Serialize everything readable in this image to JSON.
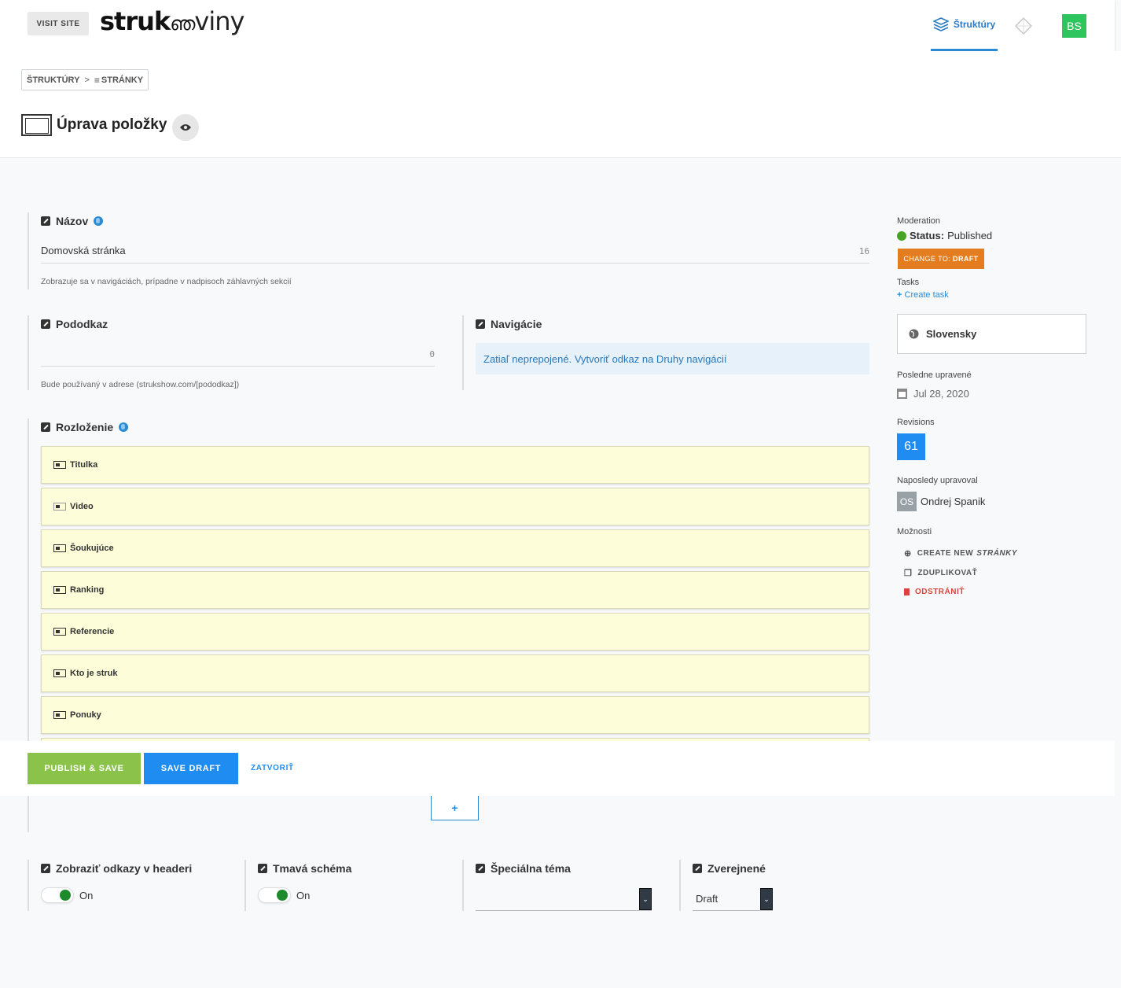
{
  "topbar": {
    "visit_site": "VISIT SITE",
    "logo_bold": "struk",
    "logo_light": "viny",
    "nav_active": "Štruktúry",
    "avatar": "BS"
  },
  "breadcrumb": {
    "root": "ŠTRUKTÚRY",
    "separator": ">",
    "current": "STRÁNKY"
  },
  "page": {
    "title": "Úprava položky"
  },
  "fields": {
    "nazov": {
      "label": "Názov",
      "value": "Domovská stránka",
      "counter": "16",
      "help": "Zobrazuje sa v navigáciách, prípadne v nadpisoch záhlavných sekcií"
    },
    "pododkaz": {
      "label": "Pododkaz",
      "value": "",
      "counter": "0",
      "help": "Bude používaný v adrese (strukshow.com/[pododkaz])"
    },
    "navigacie": {
      "label": "Navigácie",
      "text": "Zatiaľ neprepojené.",
      "link": "Vytvoriť odkaz na Druhy navigácií"
    },
    "rozlozenie": {
      "label": "Rozloženie",
      "items": [
        {
          "label": "Titulka",
          "icon": "slider-icon"
        },
        {
          "label": "Video",
          "icon": "video-icon"
        },
        {
          "label": "Šoukujúce",
          "icon": "slider-icon"
        },
        {
          "label": "Ranking",
          "icon": "ranking-icon"
        },
        {
          "label": "Referencie",
          "icon": "quote-icon"
        },
        {
          "label": "Kto je struk",
          "icon": "image-text-icon"
        },
        {
          "label": "Ponuky",
          "icon": "image-text-icon"
        }
      ]
    },
    "odkazy": {
      "label": "Zobraziť odkazy v headeri",
      "state": "On"
    },
    "tmava": {
      "label": "Tmavá schéma",
      "state": "On"
    },
    "tema": {
      "label": "Špeciálna téma",
      "value": ""
    },
    "zverejnene": {
      "label": "Zverejnené",
      "value": "Draft"
    }
  },
  "actions": {
    "publish": "PUBLISH & SAVE",
    "draft": "SAVE DRAFT",
    "close": "ZATVORIŤ",
    "add": "+"
  },
  "sidebar": {
    "moderation_label": "Moderation",
    "status_key": "Status:",
    "status_value": "Published",
    "change_prefix": "CHANGE TO:",
    "change_target": "DRAFT",
    "tasks_label": "Tasks",
    "create_task": "Create task",
    "language": "Slovensky",
    "last_modified_label": "Posledne upravené",
    "last_modified": "Jul 28, 2020",
    "revisions_label": "Revisions",
    "revisions": "61",
    "last_editor_label": "Naposledy upravoval",
    "editor_initials": "OS",
    "editor_name": "Ondrej Spanik",
    "options_label": "Možnosti",
    "opt_create": "CREATE NEW",
    "opt_create_target": "STRÁNKY",
    "opt_duplicate": "ZDUPLIKOVAŤ",
    "opt_delete": "ODSTRÁNIŤ"
  },
  "colors": {
    "accent": "#1e8cf0",
    "publish": "#8bc34a",
    "warning": "#e37d20",
    "danger": "#d9453a",
    "layout_bg": "#fdfdda"
  }
}
